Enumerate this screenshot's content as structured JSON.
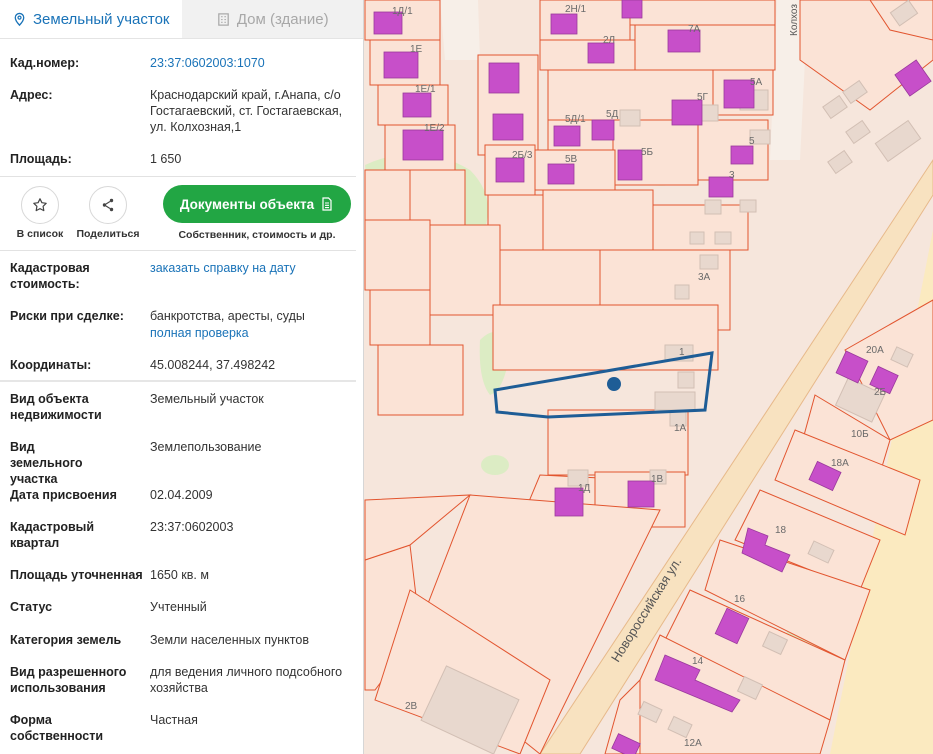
{
  "tabs": [
    {
      "label": "Земельный участок",
      "icon": "map-pin-icon",
      "active": true
    },
    {
      "label": "Дом (здание)",
      "icon": "building-icon",
      "active": false
    }
  ],
  "info": {
    "cad_number": {
      "label": "Кад.номер:",
      "value": "23:37:0602003:1070"
    },
    "address": {
      "label": "Адрес:",
      "value": "Краснодарский край, г.Анапа, с/о Гостагаевский, ст. Гостагаевская, ул. Колхозная,1"
    },
    "area": {
      "label": "Площадь:",
      "value": "1 650"
    }
  },
  "actions": {
    "add_to_list": "В список",
    "share": "Поделиться",
    "documents_button": "Документы объекта",
    "documents_sub": "Собственник, стоимость и др."
  },
  "details": {
    "cad_cost": {
      "label": "Кадастровая стоимость:",
      "value": "заказать справку на дату"
    },
    "risks": {
      "label": "Риски при сделке:",
      "value": "банкротства, аресты, суды",
      "link": "полная проверка"
    },
    "coords": {
      "label": "Координаты:",
      "value": "45.008244, 37.498242"
    }
  },
  "props": [
    {
      "label": "Вид объекта недвижимости",
      "value": "Земельный участок"
    },
    {
      "label": "Вид земельного участка",
      "value": "Землепользование"
    },
    {
      "label": "Дата присвоения",
      "value": "02.04.2009"
    },
    {
      "label": "Кадастровый квартал",
      "value": "23:37:0602003"
    },
    {
      "label": "Площадь уточненная",
      "value": "1650 кв. м"
    },
    {
      "label": "Статус",
      "value": "Учтенный"
    },
    {
      "label": "Категория земель",
      "value": "Земли населенных пунктов"
    },
    {
      "label": "Вид разрешенного использования",
      "value": "для ведения личного подсобного хозяйства"
    },
    {
      "label": "Форма собственности",
      "value": "Частная"
    }
  ],
  "map": {
    "street_main": "Новороссийская ул.",
    "street_side": "Колхоз",
    "labels": [
      "1Д/1",
      "1Е",
      "1Е/1",
      "1Е/2",
      "2Н/1",
      "2Л",
      "7А",
      "5А",
      "5Г",
      "5Д",
      "5Д/1",
      "2Б/3",
      "5В",
      "5Б",
      "5",
      "3",
      "3А",
      "1",
      "1А",
      "1В",
      "1Д",
      "20А",
      "2Б",
      "10Б",
      "18А",
      "18",
      "16",
      "14",
      "12А",
      "2В"
    ],
    "colors": {
      "parcel_fill": "#fbe3d6",
      "parcel_border": "#e2552f",
      "building": "#c74fc9",
      "selected": "#1e5d96",
      "green": "#dcecc4",
      "road": "#f6e6b3"
    }
  }
}
